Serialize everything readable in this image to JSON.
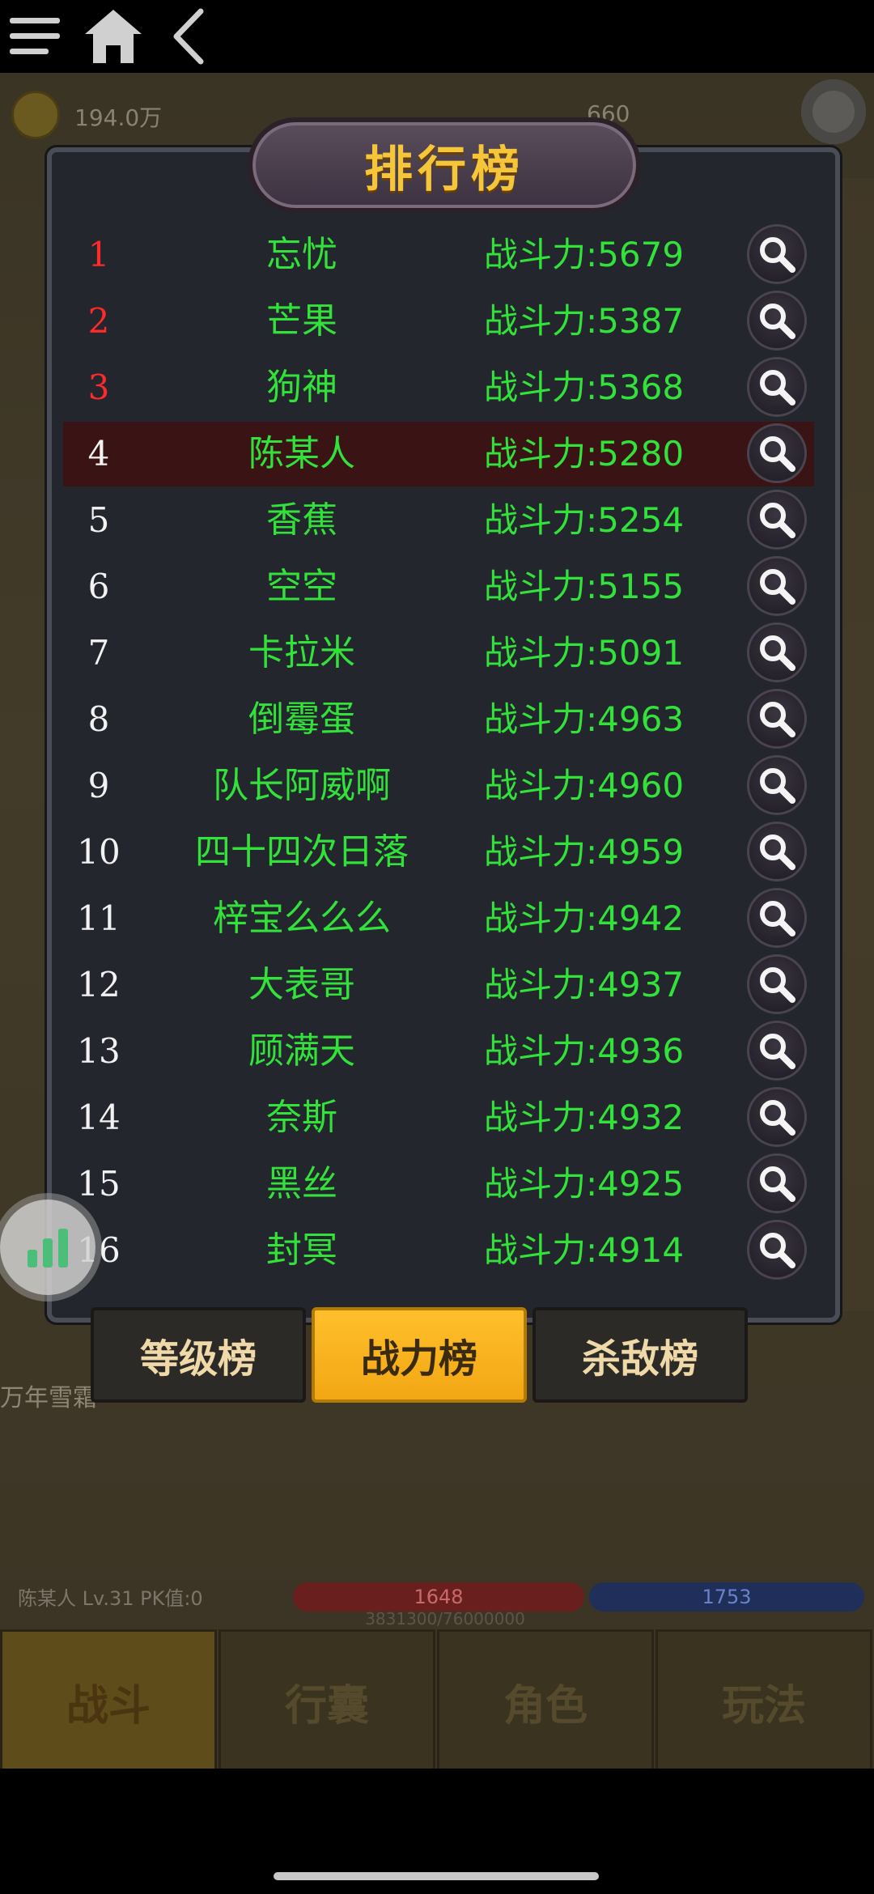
{
  "hud": {
    "gold": "194.0万",
    "right_value": "660"
  },
  "modal": {
    "title": "排行榜",
    "rows": [
      {
        "rank": "1",
        "name": "忘忧",
        "power": "战斗力:5679",
        "top": true
      },
      {
        "rank": "2",
        "name": "芒果",
        "power": "战斗力:5387",
        "top": true
      },
      {
        "rank": "3",
        "name": "狗神",
        "power": "战斗力:5368",
        "top": true
      },
      {
        "rank": "4",
        "name": "陈某人",
        "power": "战斗力:5280",
        "highlight": true
      },
      {
        "rank": "5",
        "name": "香蕉",
        "power": "战斗力:5254"
      },
      {
        "rank": "6",
        "name": "空空",
        "power": "战斗力:5155"
      },
      {
        "rank": "7",
        "name": "卡拉米",
        "power": "战斗力:5091"
      },
      {
        "rank": "8",
        "name": "倒霉蛋",
        "power": "战斗力:4963"
      },
      {
        "rank": "9",
        "name": "队长阿威啊",
        "power": "战斗力:4960"
      },
      {
        "rank": "10",
        "name": "四十四次日落",
        "power": "战斗力:4959"
      },
      {
        "rank": "11",
        "name": "梓宝么么么",
        "power": "战斗力:4942"
      },
      {
        "rank": "12",
        "name": "大表哥",
        "power": "战斗力:4937"
      },
      {
        "rank": "13",
        "name": "顾满天",
        "power": "战斗力:4936"
      },
      {
        "rank": "14",
        "name": "奈斯",
        "power": "战斗力:4932"
      },
      {
        "rank": "15",
        "name": "黑丝",
        "power": "战斗力:4925"
      },
      {
        "rank": "16",
        "name": "封冥",
        "power": "战斗力:4914"
      }
    ],
    "tabs": [
      {
        "label": "等级榜",
        "active": false
      },
      {
        "label": "战力榜",
        "active": true
      },
      {
        "label": "杀敌榜",
        "active": false
      }
    ]
  },
  "background": {
    "chat_line": "万年雪霜",
    "player_status": "陈某人 Lv.31 PK值:0",
    "hp": "1648",
    "mp": "1753",
    "exp": "3831300/76000000"
  },
  "bottom_nav": [
    "战斗",
    "行囊",
    "角色",
    "玩法"
  ],
  "icons": {
    "search": "search-icon",
    "settings": "gear-icon",
    "float": "bar-chart-icon",
    "menu": "menu-icon",
    "home": "home-icon",
    "back": "back-icon"
  },
  "colors": {
    "rank_top": "#ff2a2a",
    "name_green": "#32e23a",
    "title_gold": "#f5c53a",
    "active_tab": "#f2a713"
  }
}
